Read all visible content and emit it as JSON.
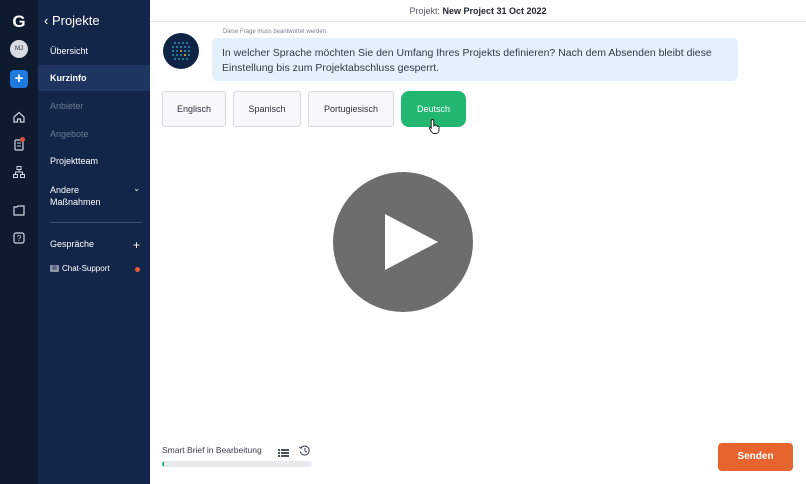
{
  "rail": {
    "logo": "G",
    "avatar_initials": "MJ",
    "add_label": "+"
  },
  "sidebar": {
    "back_title": "‹ Projekte",
    "items": [
      {
        "label": "Übersicht",
        "state": "normal"
      },
      {
        "label": "Kurzinfo",
        "state": "active"
      },
      {
        "label": "Anbieter",
        "state": "disabled"
      },
      {
        "label": "Angebote",
        "state": "disabled"
      },
      {
        "label": "Projektteam",
        "state": "normal"
      },
      {
        "label": "Andere\nMaßnahmen",
        "state": "normal"
      }
    ],
    "conversations_label": "Gespräche",
    "chat_support_label": "Chat-Support"
  },
  "header": {
    "project_prefix": "Projekt:",
    "project_name": "New Project 31 Oct 2022"
  },
  "question": {
    "hint": "Diese Frage muss beantwortet werden.",
    "text": "In welcher Sprache möchten Sie den Umfang Ihres Projekts definieren? Nach dem Absenden bleibt diese Einstellung bis zum Projektabschluss gesperrt."
  },
  "options": [
    {
      "label": "Englisch",
      "selected": false
    },
    {
      "label": "Spanisch",
      "selected": false
    },
    {
      "label": "Portugiesisch",
      "selected": false
    },
    {
      "label": "Deutsch",
      "selected": true
    }
  ],
  "footer": {
    "status_label": "Smart Brief in Bearbeitung",
    "progress_fraction": 0.01,
    "send_label": "Senden"
  },
  "colors": {
    "rail_bg": "#0e1a2e",
    "sidebar_bg": "#13264a",
    "accent_green": "#22b770",
    "send_orange": "#e8642f",
    "bubble_bg": "#e4f1fb"
  }
}
